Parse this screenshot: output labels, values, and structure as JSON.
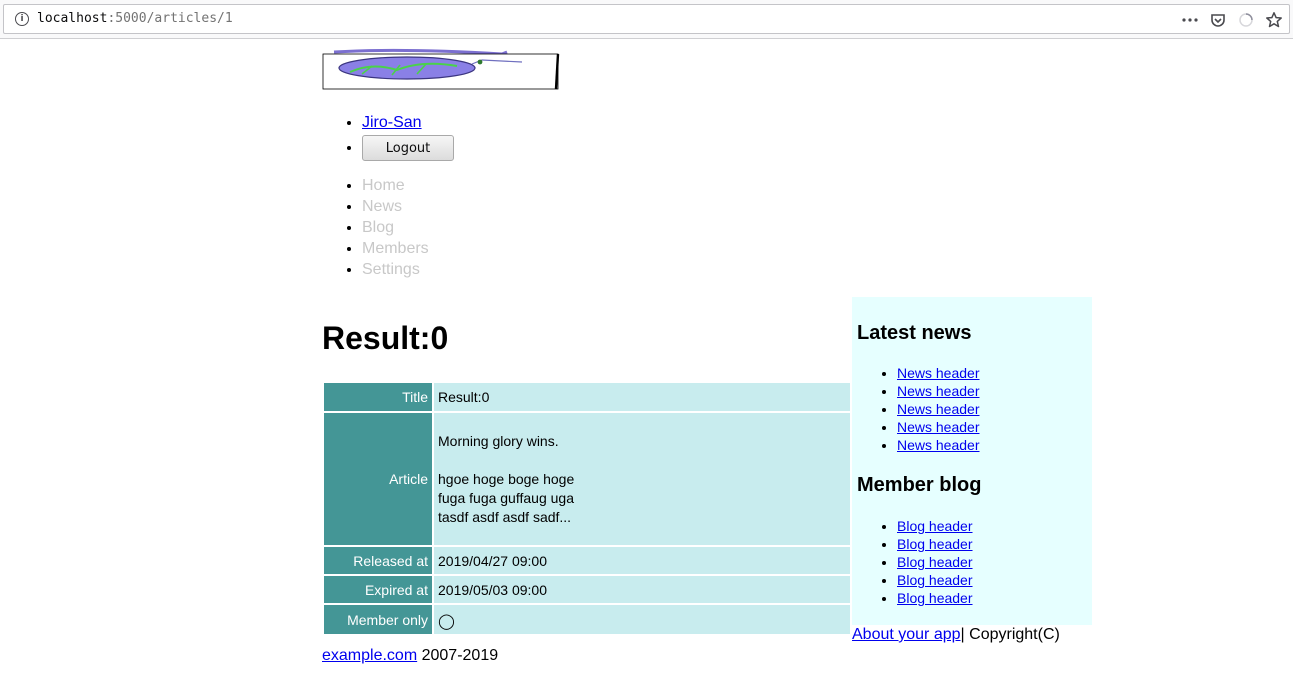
{
  "browser": {
    "url_host": "localhost",
    "url_path": ":5000/articles/1",
    "icons": [
      "info-icon",
      "more-icon",
      "pocket-icon",
      "loading-icon",
      "bookmark-star-icon"
    ]
  },
  "header": {
    "user_link": "Jiro-San",
    "logout_label": "Logout"
  },
  "nav": {
    "items": [
      {
        "label": "Home"
      },
      {
        "label": "News"
      },
      {
        "label": "Blog"
      },
      {
        "label": "Members"
      },
      {
        "label": "Settings"
      }
    ]
  },
  "article": {
    "page_title": "Result:0",
    "labels": {
      "title": "Title",
      "article": "Article",
      "released": "Released at",
      "expired": "Expired at",
      "member_only": "Member only"
    },
    "title": "Result:0",
    "body": {
      "line1": "Morning glory wins.",
      "line2": "hgoe hoge boge hoge",
      "line3": "fuga fuga guffaug uga",
      "line4": "tasdf asdf asdf sadf..."
    },
    "released_at": "2019/04/27 09:00",
    "expired_at": "2019/05/03 09:00",
    "member_only_mark": "◯"
  },
  "sidebar": {
    "news_heading": "Latest news",
    "news_items": [
      "News header",
      "News header",
      "News header",
      "News header",
      "News header"
    ],
    "blog_heading": "Member blog",
    "blog_items": [
      "Blog header",
      "Blog header",
      "Blog header",
      "Blog header",
      "Blog header"
    ]
  },
  "footer": {
    "about_link": "About your app",
    "copyright": "| Copyright(C)",
    "site_link": "example.com",
    "years": " 2007-2019"
  },
  "colors": {
    "label_cell": "#449696",
    "value_cell": "#c8ecee",
    "sidebar_bg": "#e6ffff",
    "link": "#0000ee",
    "nav_disabled": "#c8c8c8"
  }
}
